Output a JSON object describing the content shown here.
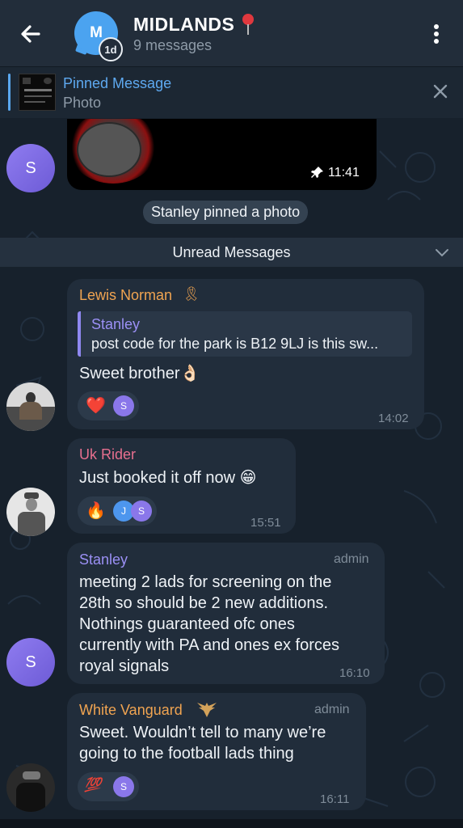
{
  "header": {
    "avatar_letter": "M",
    "timer_badge": "1d",
    "title": "MIDLANDS",
    "title_emoji": "📍",
    "subtitle": "9 messages"
  },
  "pinned": {
    "title": "Pinned Message",
    "subtitle": "Photo"
  },
  "photo_message": {
    "time": "11:41",
    "avatar_letter": "S"
  },
  "service": {
    "pinned_text": "Stanley pinned a photo",
    "unread_text": "Unread Messages"
  },
  "messages": [
    {
      "sender": "Lewis Norman",
      "sender_emoji": "🎗",
      "reply_name": "Stanley",
      "reply_text": "post code for the park is B12 9LJ is this sw...",
      "text": "Sweet brother👌🏻",
      "reaction_emoji": "❤️",
      "reaction_avatars": [
        "S"
      ],
      "time": "14:02"
    },
    {
      "sender": "Uk Rider",
      "text": "Just booked it off now 😁",
      "reaction_emoji": "🔥",
      "reaction_avatars": [
        "J",
        "S"
      ],
      "time": "15:51"
    },
    {
      "sender": "Stanley",
      "badge": "admin",
      "lines": [
        "meeting 2 lads for screening on the",
        "28th so should be 2 new additions.",
        "Nothings guaranteed ofc ones",
        "currently with PA and ones ex forces",
        "royal signals"
      ],
      "time": "16:10",
      "avatar_letter": "S"
    },
    {
      "sender": "White Vanguard",
      "badge": "admin",
      "lines": [
        "Sweet. Wouldn’t tell to many we’re",
        "going to the football lads thing"
      ],
      "reaction_emoji": "💯",
      "reaction_avatars": [
        "S"
      ],
      "time": "16:11"
    }
  ],
  "colors": {
    "background": "#17212c",
    "header": "#222d3a",
    "bubble": "#212d3b",
    "accent_blue": "#5ea9f0",
    "name_orange": "#f0a451",
    "name_pink": "#e76f8f",
    "name_purple": "#9b90f5"
  },
  "icons": [
    "back-arrow-icon",
    "more-vert-icon",
    "close-icon",
    "pin-icon",
    "chevron-down-icon"
  ]
}
